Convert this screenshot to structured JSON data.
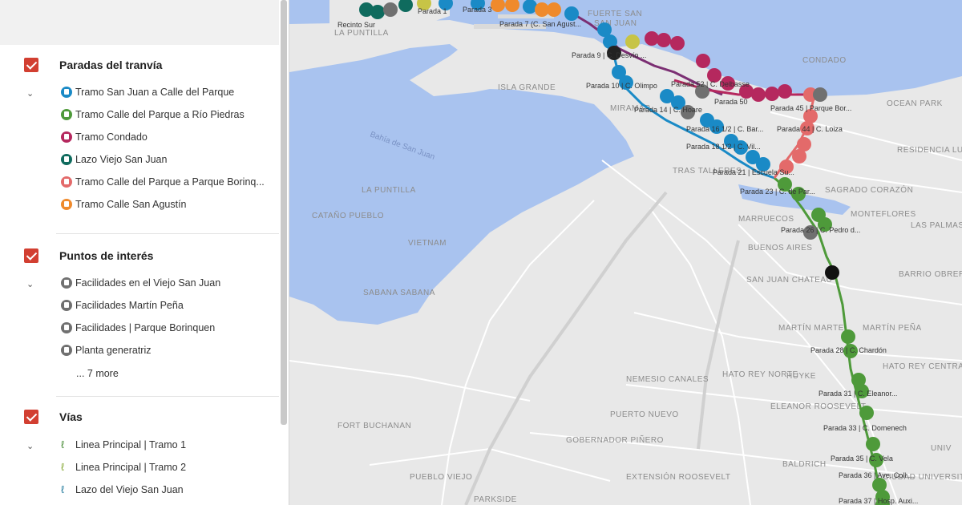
{
  "sidebar": {
    "sections": [
      {
        "title": "Paradas del tranvía",
        "checked": true,
        "items": [
          {
            "label": "Tramo San Juan a Calle del Parque",
            "color": "#1a8ac6"
          },
          {
            "label": "Tramo Calle del Parque a Río Piedras",
            "color": "#4e9a3a"
          },
          {
            "label": "Tramo Condado",
            "color": "#b5285e"
          },
          {
            "label": "Lazo Viejo San Juan",
            "color": "#0f6b5e"
          },
          {
            "label": "Tramo Calle del Parque a Parque Borinq...",
            "color": "#e36a6a"
          },
          {
            "label": "Tramo Calle San Agustín",
            "color": "#ef8a2c"
          }
        ]
      },
      {
        "title": "Puntos de interés",
        "checked": true,
        "items": [
          {
            "label": "Facilidades en el Viejo San Juan",
            "color": "#707070"
          },
          {
            "label": "Facilidades Martín Peña",
            "color": "#707070"
          },
          {
            "label": "Facilidades | Parque Borinquen",
            "color": "#707070"
          },
          {
            "label": "Planta generatriz",
            "color": "#707070"
          }
        ],
        "more": "... 7 more"
      },
      {
        "title": "Vías",
        "checked": true,
        "items": [
          {
            "label": "Linea Principal | Tramo 1",
            "icon": "line-icon"
          },
          {
            "label": "Linea Principal | Tramo 2",
            "icon": "line-icon"
          },
          {
            "label": "Lazo del Viejo San Juan",
            "icon": "line-icon"
          }
        ]
      }
    ]
  },
  "map": {
    "colors": {
      "water": "#a9c3ef",
      "land": "#e8e8e8",
      "blue": "#1a8ac6",
      "green": "#4e9a3a",
      "magenta": "#b5285e",
      "red": "#e36a6a",
      "orange": "#ef8a2c",
      "teal": "#0f6b5e",
      "gray": "#707070"
    },
    "neighborhoods": [
      "LA PUNTILLA",
      "FUERTE SAN",
      "ISLA GRANDE",
      "MIRAMAR",
      "SAN JUAN",
      "CONDADO",
      "OCEAN PARK",
      "RESIDENCIA LUIS LLORENS TORRES",
      "TRAS TALLERES",
      "SAGRADO CORAZÓN",
      "LA PUNTILLA",
      "CATAÑO PUEBLO",
      "VIETNAM",
      "MARRUECOS",
      "BUENOS AIRES",
      "LAS PALMAS",
      "MONTEFLORES",
      "BARRIO OBRERO",
      "SABANA SABANA",
      "SAN JUAN CHATEAU",
      "MARTÍN MARTEL",
      "MARTÍN PEÑA",
      "HATO REY NORTE",
      "HATO REY CENTRAL",
      "HUYKE",
      "ELEANOR ROOSEVELT",
      "NEMESIO CANALES",
      "PUERTO NUEVO",
      "FORT BUCHANAN",
      "GOBERNADOR PIÑERO",
      "BALDRICH",
      "PUEBLO VIEJO",
      "EXTENSIÓN ROOSEVELT",
      "PARKSIDE",
      "UNIV",
      "CIUDAD UNIVERSITARIA"
    ],
    "water_labels": [
      "Bahía de San Juan"
    ],
    "stop_labels": [
      "Recinto Sur",
      "Parada 1",
      "Parada 3",
      "Parada 7 (C. San Agust...",
      "Parada 9 | C. Desvío ...",
      "Parada 10 | C. Olimpo",
      "Parada 52 | C. Delbasse",
      "Parada 50",
      "Parada 45 | Parque Bor...",
      "Parada 14 | C. Hoare",
      "Parada 44 | C. Loiza",
      "Parada 16 1/2 | C. Bar...",
      "Parada 18 1/2 | C. Vil...",
      "Parada 21 | Escuela Su...",
      "Parada 23 | C. de Par...",
      "Parada 26 | C. Pedro d...",
      "Parada 28 | C. Chardón",
      "Parada 31 | C. Eleanor...",
      "Parada 33 | C. Domenech",
      "Parada 35 | C. Vela",
      "Parada 36 | Ave. Coll ...",
      "Parada 37 | Hosp. Auxi..."
    ]
  }
}
